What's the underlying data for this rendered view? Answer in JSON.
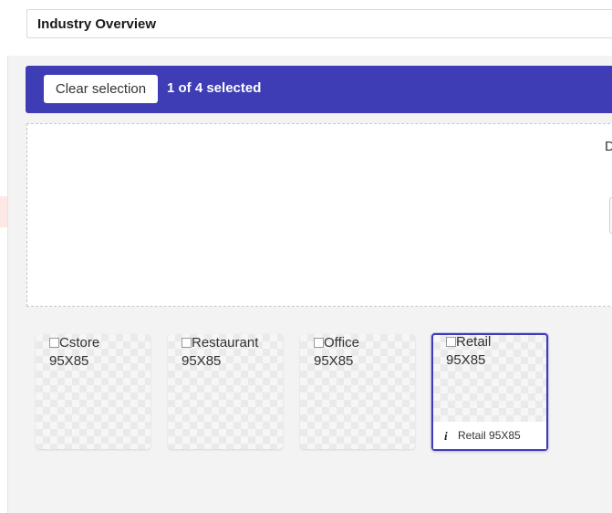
{
  "header": {
    "title": "Industry Overview"
  },
  "selection_bar": {
    "clear_label": "Clear selection",
    "count_text": "1 of 4 selected",
    "background": "#3e3db5"
  },
  "dropzone": {
    "partial_text": "D"
  },
  "tiles": [
    {
      "alt_line1": "Cstore",
      "alt_line2": "95X85",
      "selected": false
    },
    {
      "alt_line1": "Restaurant",
      "alt_line2": "95X85",
      "selected": false
    },
    {
      "alt_line1": "Office",
      "alt_line2": "95X85",
      "selected": false
    },
    {
      "alt_line1": "Retail",
      "alt_line2": "95X85",
      "selected": true,
      "caption": "Retail 95X85",
      "caption_icon": "info-icon"
    }
  ]
}
